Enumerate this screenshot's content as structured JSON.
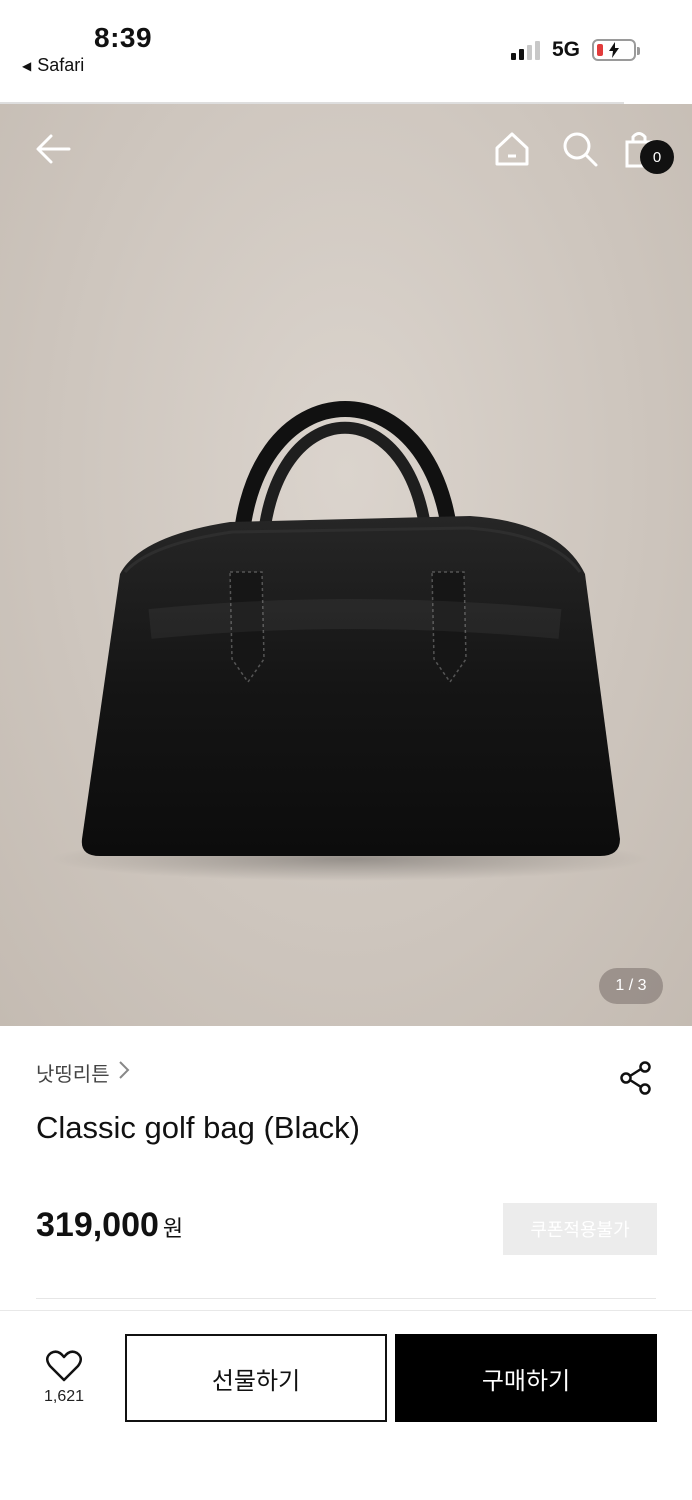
{
  "status_bar": {
    "time": "8:39",
    "back_app": "Safari",
    "network": "5G"
  },
  "nav": {
    "cart_count": "0"
  },
  "gallery": {
    "indicator": "1 / 3"
  },
  "product": {
    "brand": "낫띵리튼",
    "title": "Classic golf bag (Black)",
    "price": "319,000",
    "currency": "원",
    "coupon_label": "쿠폰적용불가"
  },
  "actions": {
    "like_count": "1,621",
    "gift_label": "선물하기",
    "buy_label": "구매하기"
  },
  "colors": {
    "primary": "#000000",
    "badge": "#111111",
    "hero_bg": "#d2cbc4",
    "battery_low": "#e23b3b"
  }
}
